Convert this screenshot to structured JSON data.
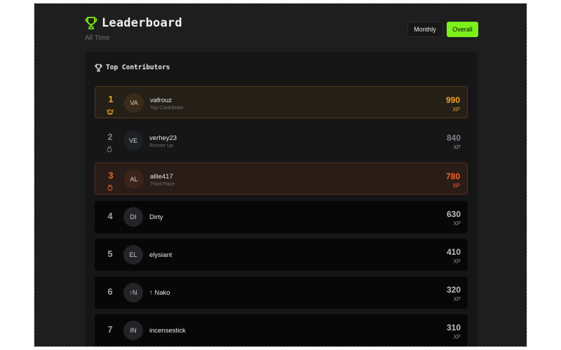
{
  "header": {
    "title": "Leaderboard",
    "subtitle": "All Time",
    "icon": "trophy-icon",
    "accent": "#7cf01a"
  },
  "toggle": {
    "monthly_label": "Monthly",
    "overall_label": "Overall",
    "selected": "Overall"
  },
  "card": {
    "title": "Top Contributors",
    "icon": "trophy-icon"
  },
  "entries": [
    {
      "rank": "1",
      "initials": "VA",
      "name": "vafrouz",
      "role": "Top Contributor",
      "xp": "990",
      "unit": "XP",
      "medal": "crown-icon",
      "color": "#f2a321"
    },
    {
      "rank": "2",
      "initials": "VE",
      "name": "verhey23",
      "role": "Runner Up",
      "xp": "840",
      "unit": "XP",
      "medal": "medal-icon",
      "color": "#7f8189"
    },
    {
      "rank": "3",
      "initials": "AL",
      "name": "allie417",
      "role": "Third Place",
      "xp": "780",
      "unit": "XP",
      "medal": "medal-icon",
      "color": "#f2662a"
    },
    {
      "rank": "4",
      "initials": "DI",
      "name": "Dirty",
      "xp": "630",
      "unit": "XP"
    },
    {
      "rank": "5",
      "initials": "EL",
      "name": "elysiant",
      "xp": "410",
      "unit": "XP"
    },
    {
      "rank": "6",
      "initials": "↑N",
      "name": "↑ Nako",
      "xp": "320",
      "unit": "XP"
    },
    {
      "rank": "7",
      "initials": "IN",
      "name": "incensestick",
      "xp": "310",
      "unit": "XP"
    }
  ]
}
